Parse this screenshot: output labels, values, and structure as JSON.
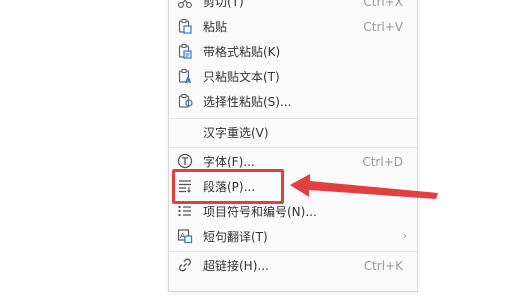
{
  "context_menu": {
    "items": [
      {
        "label": "剪切(T)",
        "shortcut": "Ctrl+X",
        "icon": "scissors-icon"
      },
      {
        "label": "粘贴",
        "shortcut": "Ctrl+V",
        "icon": "paste-icon"
      },
      {
        "label": "带格式粘贴(K)",
        "shortcut": "",
        "icon": "paste-formatted-icon"
      },
      {
        "label": "只粘贴文本(T)",
        "shortcut": "",
        "icon": "paste-text-only-icon"
      },
      {
        "label": "选择性粘贴(S)...",
        "shortcut": "",
        "icon": "paste-special-icon"
      },
      {
        "label": "汉字重选(V)",
        "shortcut": "",
        "icon": ""
      },
      {
        "label": "字体(F)...",
        "shortcut": "Ctrl+D",
        "icon": "font-icon"
      },
      {
        "label": "段落(P)...",
        "shortcut": "",
        "icon": "paragraph-icon"
      },
      {
        "label": "项目符号和编号(N)...",
        "shortcut": "",
        "icon": "list-bullets-icon"
      },
      {
        "label": "短句翻译(T)",
        "shortcut": "",
        "icon": "translate-icon",
        "submenu": "›"
      },
      {
        "label": "超链接(H)...",
        "shortcut": "Ctrl+K",
        "icon": "hyperlink-icon"
      }
    ]
  },
  "annotation": {
    "highlight_color": "#e24040"
  }
}
